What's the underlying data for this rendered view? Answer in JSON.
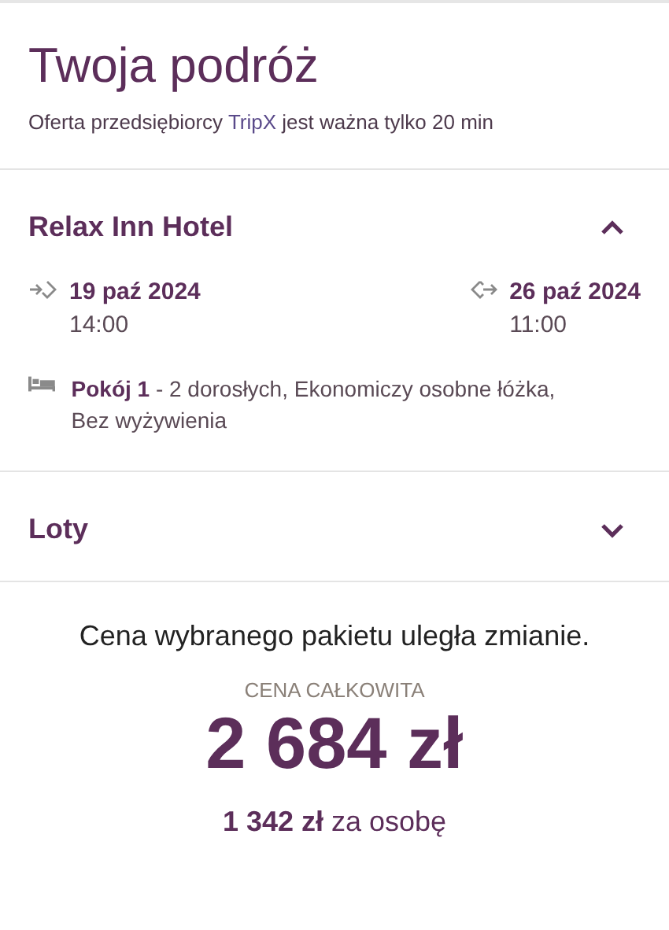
{
  "header": {
    "title": "Twoja podróż",
    "subtitle_before": "Oferta przedsiębiorcy ",
    "provider": "TripX",
    "subtitle_after": " jest ważna tylko 20 min"
  },
  "sections": [
    {
      "title": "Relax Inn Hotel",
      "expanded": true,
      "check_in": {
        "date": "19 paź 2024",
        "time": "14:00"
      },
      "check_out": {
        "date": "26 paź 2024",
        "time": "11:00"
      },
      "room": "**Pokój 1**  - 2 dorosłych, Ekonomiczy osobne łóżka, Bez wyżywienia"
    },
    {
      "title": "Loty",
      "expanded": false
    }
  ],
  "price": {
    "notice": "Cena wybranego pakietu uległa zmianie.",
    "label": "CENA CAŁKOWITA",
    "total": "2 684 zł",
    "per_person": "**1 342 zł** za osobę"
  }
}
